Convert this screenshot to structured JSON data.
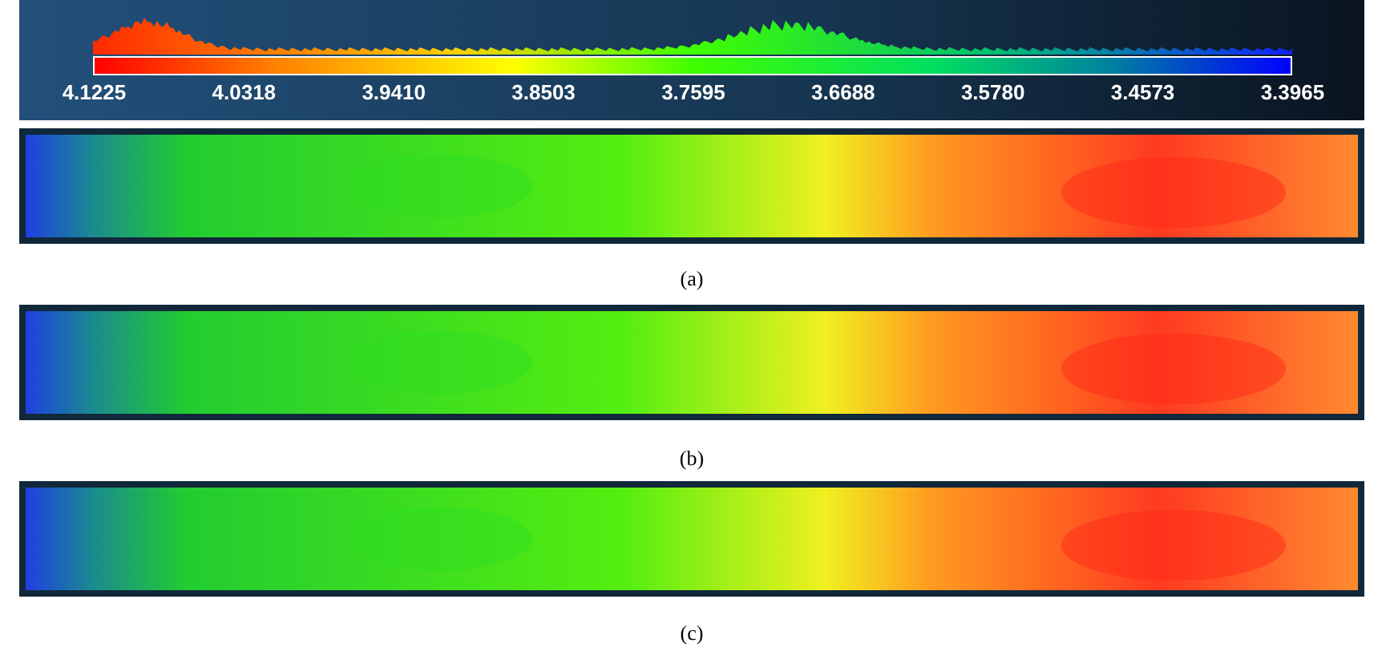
{
  "color_scale": {
    "ticks": [
      "4.1225",
      "4.0318",
      "3.9410",
      "3.8503",
      "3.7595",
      "3.6688",
      "3.5780",
      "3.4573",
      "3.3965"
    ]
  },
  "maps": [
    {
      "kind": "picture",
      "caption": "(a)"
    },
    {
      "kind": "picture",
      "caption": "(b)"
    },
    {
      "kind": "picture",
      "caption": "(c)"
    }
  ]
}
